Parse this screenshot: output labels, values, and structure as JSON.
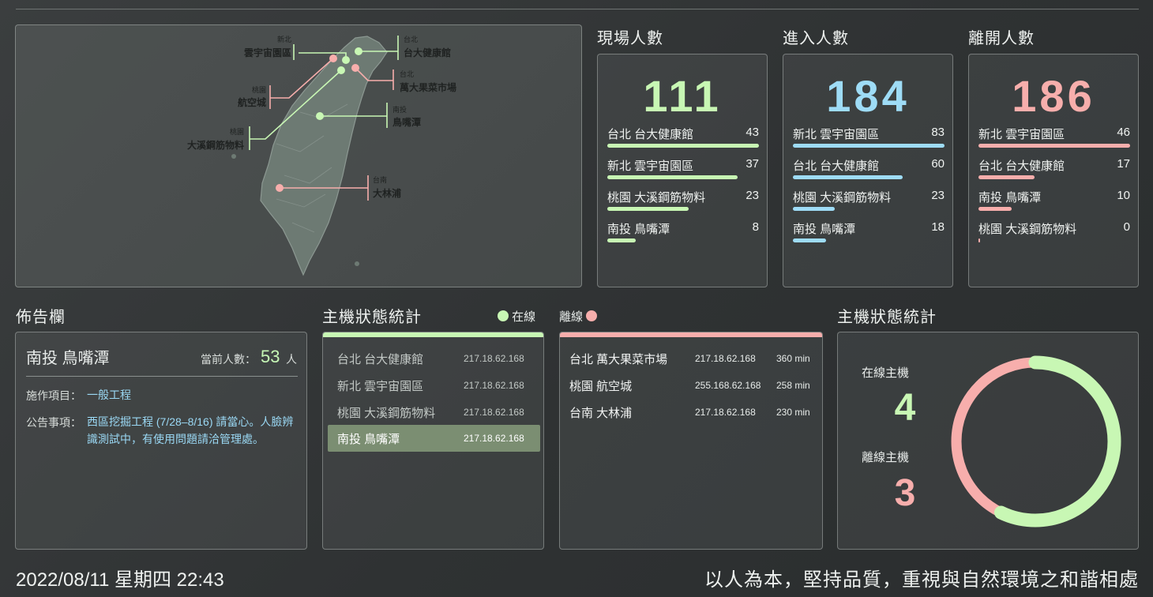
{
  "map": {
    "labels": [
      {
        "city": "新北",
        "site": "雲宇宙園區"
      },
      {
        "city": "台北",
        "site": "台大健康館"
      },
      {
        "city": "台北",
        "site": "萬大果菜市場"
      },
      {
        "city": "桃園",
        "site": "航空城"
      },
      {
        "city": "南投",
        "site": "鳥嘴潭"
      },
      {
        "city": "桃園",
        "site": "大溪鋼筋物料"
      },
      {
        "city": "台南",
        "site": "大林浦"
      }
    ]
  },
  "counts": {
    "onsite": {
      "title": "現場人數",
      "total": "111",
      "color": "#c8f7b4",
      "rows": [
        {
          "name": "台北 台大健康館",
          "value": 43
        },
        {
          "name": "新北 雲宇宙園區",
          "value": 37
        },
        {
          "name": "桃園 大溪鋼筋物料",
          "value": 23
        },
        {
          "name": "南投 鳥嘴潭",
          "value": 8
        }
      ]
    },
    "entered": {
      "title": "進入人數",
      "total": "184",
      "color": "#9edcf6",
      "rows": [
        {
          "name": "新北 雲宇宙園區",
          "value": 83
        },
        {
          "name": "台北 台大健康館",
          "value": 60
        },
        {
          "name": "桃園 大溪鋼筋物料",
          "value": 23
        },
        {
          "name": "南投 鳥嘴潭",
          "value": 18
        }
      ]
    },
    "left": {
      "title": "離開人數",
      "total": "186",
      "color": "#f7aeac",
      "rows": [
        {
          "name": "新北 雲宇宙園區",
          "value": 46
        },
        {
          "name": "台北 台大健康館",
          "value": 17
        },
        {
          "name": "南投 鳥嘴潭",
          "value": 10
        },
        {
          "name": "桃園 大溪鋼筋物料",
          "value": 0
        }
      ]
    }
  },
  "notice": {
    "title": "佈告欄",
    "site": "南投 鳥嘴潭",
    "count_label": "當前人數：",
    "count": "53",
    "count_unit": "人",
    "item_label": "施作項目：",
    "item_value": "一般工程",
    "announce_label": "公告事項：",
    "announce_value": "西區挖掘工程 (7/28–8/16) 請當心。人臉辨識測試中，有使用問題請洽管理處。"
  },
  "hosts": {
    "title": "主機狀態統計",
    "online_legend": "在線",
    "offline_legend": "離線",
    "online": [
      {
        "name": "台北 台大健康館",
        "ip": "217.18.62.168"
      },
      {
        "name": "新北 雲宇宙園區",
        "ip": "217.18.62.168"
      },
      {
        "name": "桃園 大溪鋼筋物料",
        "ip": "217.18.62.168"
      },
      {
        "name": "南投 鳥嘴潭",
        "ip": "217.18.62.168"
      }
    ],
    "offline": [
      {
        "name": "台北 萬大果菜市場",
        "ip": "217.18.62.168",
        "min": "360 min"
      },
      {
        "name": "桃園 航空城",
        "ip": "255.168.62.168",
        "min": "258 min"
      },
      {
        "name": "台南 大林浦",
        "ip": "217.18.62.168",
        "min": "230 min"
      }
    ]
  },
  "stats": {
    "title": "主機狀態統計",
    "online_label": "在線主機",
    "online_count": "4",
    "offline_label": "離線主機",
    "offline_count": "3",
    "online_color": "#c8f7b4",
    "offline_color": "#f7aeac"
  },
  "footer": {
    "datetime": "2022/08/11  星期四 22:43",
    "slogan": "以人為本，堅持品質，重視與自然環境之和諧相處"
  },
  "colors": {
    "green": "#c8f7b4",
    "blue": "#9edcf6",
    "pink": "#f7aeac",
    "highlight": "#7b8e72"
  }
}
